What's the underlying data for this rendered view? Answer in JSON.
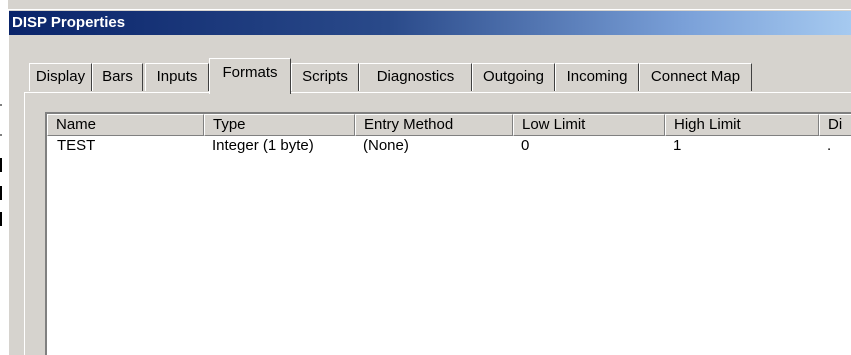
{
  "window": {
    "title": "DISP Properties"
  },
  "tabs": [
    {
      "label": "Display",
      "active": false
    },
    {
      "label": "Bars",
      "active": false
    },
    {
      "label": "Inputs",
      "active": false
    },
    {
      "label": "Formats",
      "active": true
    },
    {
      "label": "Scripts",
      "active": false
    },
    {
      "label": "Diagnostics",
      "active": false
    },
    {
      "label": "Outgoing",
      "active": false
    },
    {
      "label": "Incoming",
      "active": false
    },
    {
      "label": "Connect Map",
      "active": false
    }
  ],
  "list": {
    "columns": [
      "Name",
      "Type",
      "Entry Method",
      "Low Limit",
      "High Limit",
      "Di"
    ],
    "rows": [
      {
        "name": "TEST",
        "type": "Integer (1 byte)",
        "entry_method": "(None)",
        "low_limit": "0",
        "high_limit": "1",
        "di": "."
      }
    ]
  },
  "colors": {
    "titlebar_start": "#0a246a",
    "titlebar_end": "#a6caf0",
    "face": "#d6d3ce"
  }
}
